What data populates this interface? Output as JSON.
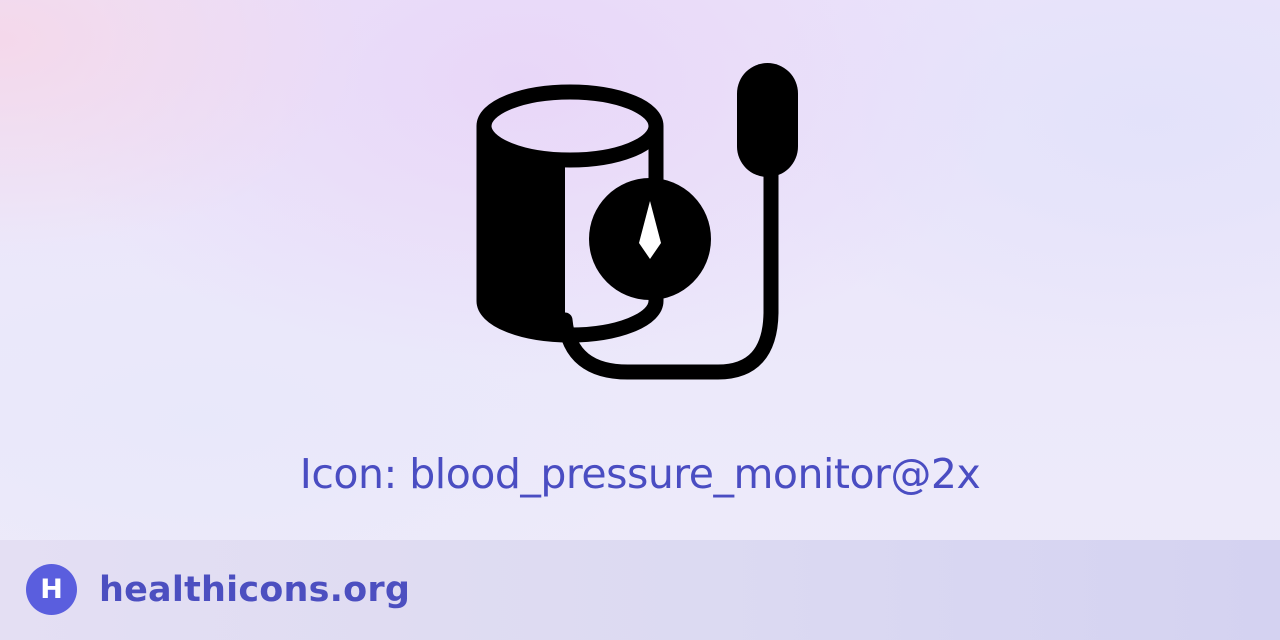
{
  "icon": {
    "name": "blood-pressure-monitor-icon",
    "color": "#000000"
  },
  "caption": {
    "text": "Icon: blood_pressure_monitor@2x",
    "color": "#4a4dc2"
  },
  "footer": {
    "logo_letter": "H",
    "logo_color": "#5a5ede",
    "site_name": "healthicons.org",
    "site_color": "#4c4fc0"
  }
}
